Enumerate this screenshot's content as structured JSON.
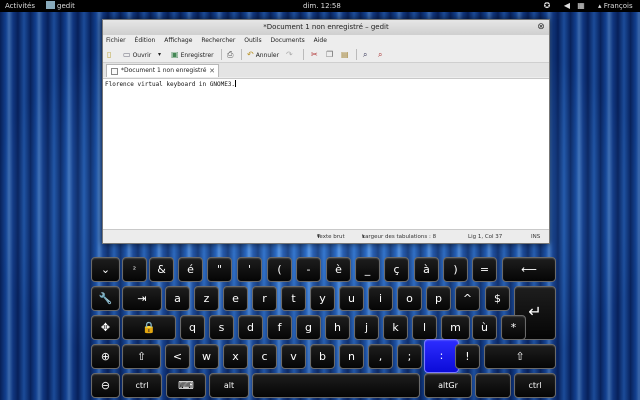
{
  "topbar": {
    "activities": "Activités",
    "app_name": "gedit",
    "clock": "dim. 12:58",
    "tray_icons": [
      "accessibility-icon",
      "volume-icon",
      "network-icon",
      "power-icon"
    ],
    "language": "François"
  },
  "window": {
    "title": "*Document 1 non enregistré – gedit",
    "menu": [
      "Fichier",
      "Édition",
      "Affichage",
      "Rechercher",
      "Outils",
      "Documents",
      "Aide"
    ],
    "toolbar": {
      "open": "Ouvrir",
      "save": "Enregistrer",
      "undo": "Annuler"
    },
    "tab_label": "*Document 1 non enregistré",
    "content": "Florence virtual keyboard in GNOME3.",
    "status": {
      "text_mode": "Texte brut",
      "tab_width": "Largeur des tabulations : 8",
      "position": "Lig 1, Col 37",
      "insert_mode": "INS"
    }
  },
  "keyboard": {
    "highlight_color": "#1414f0",
    "rows": [
      [
        "⌄",
        "²",
        "&",
        "é",
        "\"",
        "'",
        "(",
        "-",
        "è",
        "_",
        "ç",
        "à",
        ")",
        "=",
        "⟵"
      ],
      [
        "🔧",
        "⇥",
        "a",
        "z",
        "e",
        "r",
        "t",
        "y",
        "u",
        "i",
        "o",
        "p",
        "^",
        "$",
        "↵"
      ],
      [
        "✥",
        "🔒",
        "q",
        "s",
        "d",
        "f",
        "g",
        "h",
        "j",
        "k",
        "l",
        "m",
        "ù",
        "*"
      ],
      [
        "⊕",
        "⇧",
        "<",
        "w",
        "x",
        "c",
        "v",
        "b",
        "n",
        ",",
        ";",
        ":",
        "!",
        "⇧"
      ],
      [
        "⊖",
        "ctrl",
        "⌨",
        "alt",
        "",
        "altGr",
        "",
        "ctrl"
      ]
    ]
  }
}
